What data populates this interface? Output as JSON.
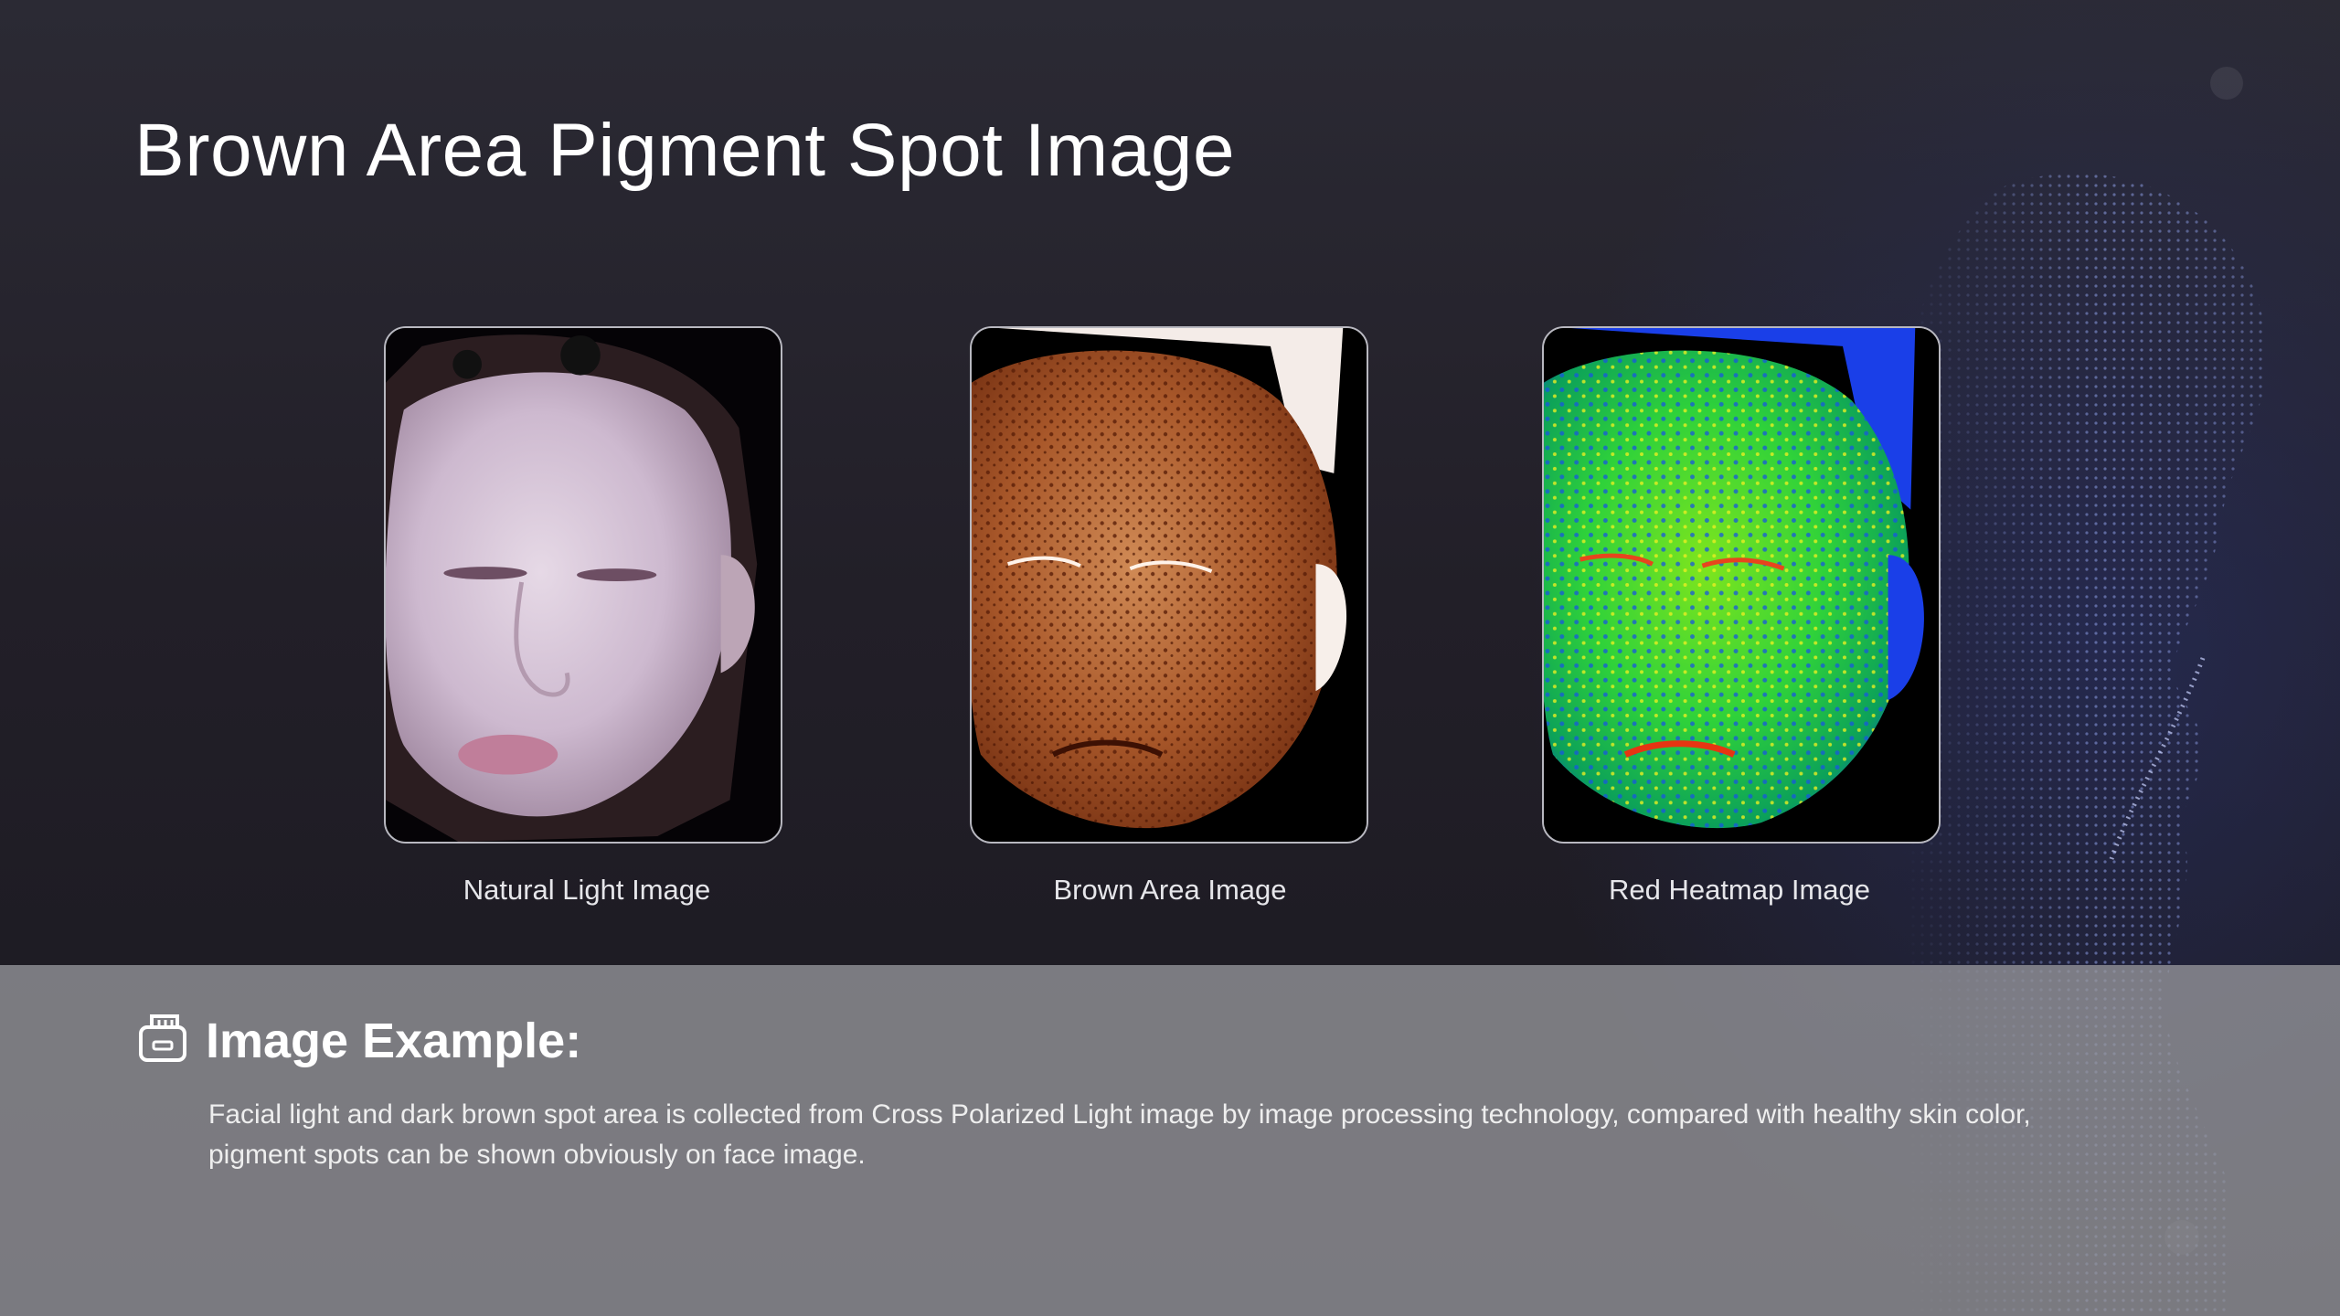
{
  "slide": {
    "title": "Brown Area Pigment Spot Image"
  },
  "images": [
    {
      "caption": "Natural Light Image",
      "icon": "natural-light-face-photo"
    },
    {
      "caption": "Brown Area Image",
      "icon": "brown-area-face-photo"
    },
    {
      "caption": "Red Heatmap Image",
      "icon": "red-heatmap-face-photo"
    }
  ],
  "example": {
    "icon": "document-icon",
    "heading": "Image Example:",
    "text": "Facial light and dark brown spot area is collected from Cross Polarized Light image by image processing technology, compared with healthy skin color, pigment spots can be shown obviously on face image."
  },
  "colors": {
    "background_top": "#2b2a34",
    "background_bottom": "#1a1920",
    "panel": "#96969b",
    "title_text": "#ffffff",
    "caption_text": "#e6e6ea"
  }
}
